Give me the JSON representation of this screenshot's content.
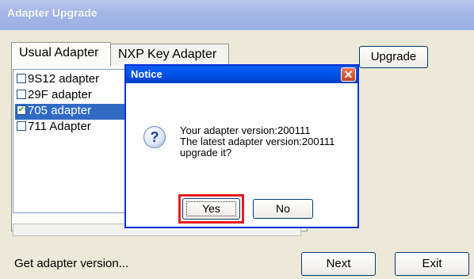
{
  "window": {
    "title": "Adapter Upgrade"
  },
  "tabs": [
    {
      "label": "Usual Adapter",
      "active": true
    },
    {
      "label": "NXP Key Adapter",
      "active": false
    }
  ],
  "adapter_list": {
    "items": [
      {
        "label": "9S12 adapter",
        "checked": false,
        "selected": false
      },
      {
        "label": "29F adapter",
        "checked": false,
        "selected": false
      },
      {
        "label": "705 adapter",
        "checked": true,
        "selected": true
      },
      {
        "label": "711 Adapter",
        "checked": false,
        "selected": false
      }
    ]
  },
  "buttons": {
    "upgrade": "Upgrade",
    "next": "Next",
    "exit": "Exit"
  },
  "status": {
    "text": "Get adapter version..."
  },
  "notice": {
    "title": "Notice",
    "close_glyph": "✕",
    "icon": "question-icon",
    "icon_glyph": "?",
    "lines": [
      "Your adapter version:200111",
      "The latest adapter version:200111",
      "upgrade it?"
    ],
    "yes_label": "Yes",
    "no_label": "No"
  },
  "colors": {
    "selection": "#316ac5",
    "dialog_title": "#0058ee",
    "focus_highlight": "#e31c23"
  }
}
